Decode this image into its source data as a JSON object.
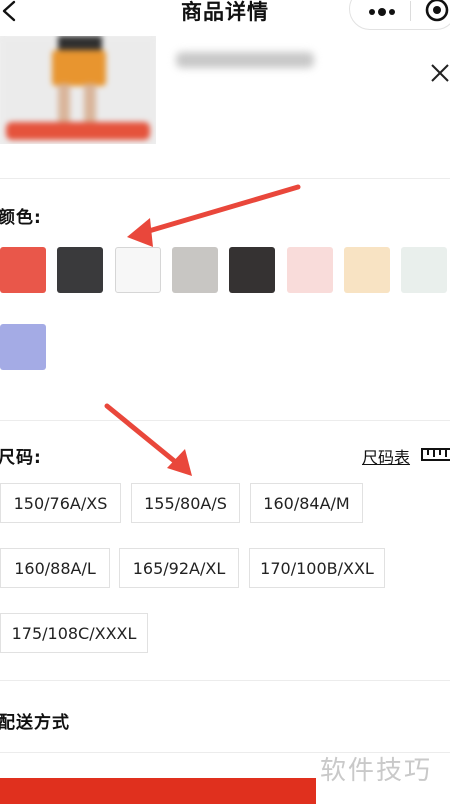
{
  "nav": {
    "title": "商品详情"
  },
  "colors": {
    "label": "颜色:",
    "swatches": [
      {
        "name": "red",
        "hex": "#e9574a"
      },
      {
        "name": "dark-gray",
        "hex": "#3a3a3c"
      },
      {
        "name": "white",
        "hex": "#f7f7f7"
      },
      {
        "name": "light-gray",
        "hex": "#c8c6c3"
      },
      {
        "name": "charcoal",
        "hex": "#353232"
      },
      {
        "name": "pink",
        "hex": "#f9dcda"
      },
      {
        "name": "cream",
        "hex": "#f8e3c3"
      },
      {
        "name": "off-white",
        "hex": "#e9efec"
      },
      {
        "name": "lavender",
        "hex": "#a4abe5"
      }
    ]
  },
  "sizes": {
    "label": "尺码:",
    "chart_label": "尺码表",
    "options": [
      "150/76A/XS",
      "155/80A/S",
      "160/84A/M",
      "160/88A/L",
      "165/92A/XL",
      "170/100B/XXL",
      "175/108C/XXXL"
    ]
  },
  "delivery": {
    "label": "配送方式"
  },
  "watermark": "软件技巧",
  "accent": "#e0301e",
  "annotation_arrow_color": "#e9473b"
}
